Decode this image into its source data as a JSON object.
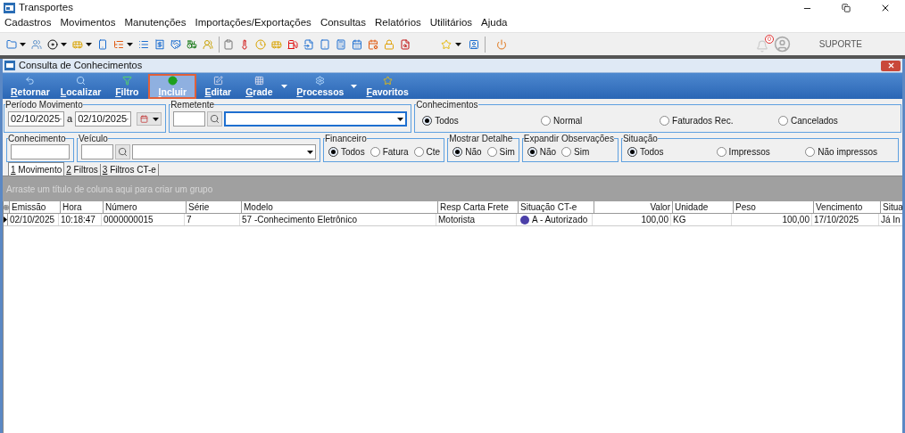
{
  "app": {
    "title": "Transportes"
  },
  "menu": [
    "Cadastros",
    "Movimentos",
    "Manutenções",
    "Importações/Exportações",
    "Consultas",
    "Relatórios",
    "Utilitários",
    "Ajuda"
  ],
  "toolbar": {
    "notification_count": "0",
    "user": "SUPORTE"
  },
  "window": {
    "title": "Consulta de Conhecimentos"
  },
  "ribbon": [
    {
      "label": "Retornar",
      "selected": false,
      "dropdown": false
    },
    {
      "label": "Localizar",
      "selected": false,
      "dropdown": false
    },
    {
      "label": "Filtro",
      "selected": false,
      "dropdown": false
    },
    {
      "label": "Incluir",
      "selected": true,
      "dropdown": false
    },
    {
      "label": "Editar",
      "selected": false,
      "dropdown": false
    },
    {
      "label": "Grade",
      "selected": false,
      "dropdown": true
    },
    {
      "label": "Processos",
      "selected": false,
      "dropdown": true
    },
    {
      "label": "Favoritos",
      "selected": false,
      "dropdown": false
    }
  ],
  "filters": {
    "periodo": {
      "label": "Período Movimento",
      "from": "02/10/2025",
      "separator": "a",
      "to": "02/10/2025"
    },
    "remetente": {
      "label": "Remetente"
    },
    "conhecimentos": {
      "label": "Conhecimentos",
      "options": [
        {
          "label": "Todos",
          "selected": true
        },
        {
          "label": "Normal",
          "selected": false
        },
        {
          "label": "Faturados Rec.",
          "selected": false
        },
        {
          "label": "Cancelados",
          "selected": false
        }
      ]
    },
    "conhecimento": {
      "label": "Conhecimento"
    },
    "veiculo": {
      "label": "Veículo"
    },
    "radio_groups": [
      {
        "label": "Financeiro",
        "options": [
          {
            "label": "Todos",
            "selected": true
          },
          {
            "label": "Fatura",
            "selected": false
          },
          {
            "label": "Cte",
            "selected": false
          }
        ]
      },
      {
        "label": "Mostrar Detalhe",
        "options": [
          {
            "label": "Não",
            "selected": true
          },
          {
            "label": "Sim",
            "selected": false
          }
        ]
      },
      {
        "label": "Expandir Observações",
        "options": [
          {
            "label": "Não",
            "selected": true
          },
          {
            "label": "Sim",
            "selected": false
          }
        ]
      },
      {
        "label": "Situação",
        "options": [
          {
            "label": "Todos",
            "selected": true
          },
          {
            "label": "Impressos",
            "selected": false
          },
          {
            "label": "Não impressos",
            "selected": false
          }
        ]
      }
    ]
  },
  "tabs": [
    {
      "label": "1 Movimento",
      "selected": true
    },
    {
      "label": "2 Filtros",
      "selected": false
    },
    {
      "label": "3 Filtros CT-e",
      "selected": false
    }
  ],
  "group_panel": {
    "hint": "Arraste um título de coluna aqui para criar um grupo"
  },
  "table": {
    "columns": [
      {
        "label": "Emissão"
      },
      {
        "label": "Hora"
      },
      {
        "label": "Número"
      },
      {
        "label": "Série"
      },
      {
        "label": "Modelo"
      },
      {
        "label": "Resp Carta Frete"
      },
      {
        "label": "Situação CT-e"
      },
      {
        "label": "Valor"
      },
      {
        "label": "Unidade"
      },
      {
        "label": "Peso"
      },
      {
        "label": "Vencimento"
      },
      {
        "label": "Situa"
      }
    ],
    "rows": [
      {
        "current": true,
        "cells": [
          "02/10/2025",
          "10:18:47",
          "0000000015",
          "7",
          "57 -Conhecimento Eletrônico",
          "Motorista",
          "A - Autorizado",
          "100,00",
          "KG",
          "100,00",
          "17/10/2025",
          "Já In"
        ]
      }
    ]
  }
}
